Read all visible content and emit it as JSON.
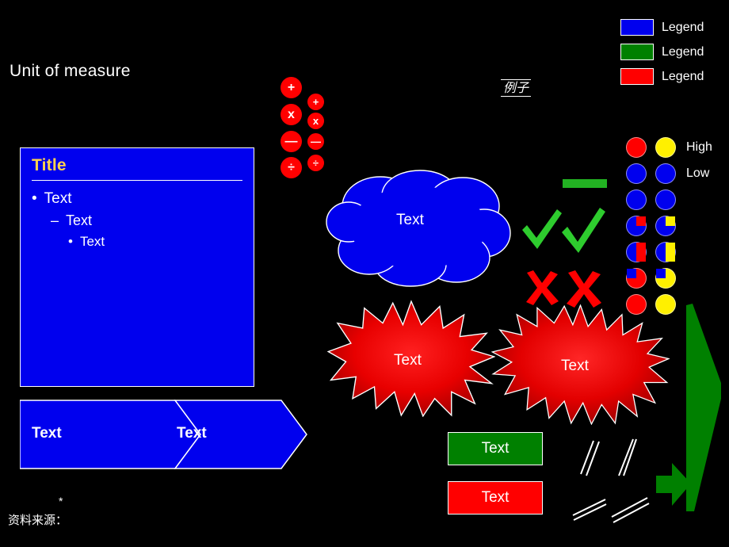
{
  "slide": {
    "background_color": "#000000",
    "heading": "Unit of measure"
  },
  "content_box": {
    "title": "Title",
    "title_color": "#FFD24D",
    "fill_color": "#0000EE",
    "bullets": [
      {
        "level": 1,
        "mark": "•",
        "text": "Text"
      },
      {
        "level": 2,
        "mark": "–",
        "text": "Text"
      },
      {
        "level": 3,
        "mark": "•",
        "text": "Text"
      }
    ]
  },
  "chevron": {
    "fill_color": "#0000EE",
    "segments": [
      {
        "label": "Text"
      },
      {
        "label": "Text"
      }
    ]
  },
  "footnote": {
    "star": "*",
    "source": "资料来源："
  },
  "math_symbols": {
    "large": [
      {
        "name": "plus-symbol",
        "glyph": "+"
      },
      {
        "name": "multiply-symbol",
        "glyph": "x"
      },
      {
        "name": "minus-symbol",
        "glyph": "—"
      },
      {
        "name": "divide-symbol",
        "glyph": "÷"
      }
    ],
    "small": [
      {
        "name": "plus-symbol",
        "glyph": "+"
      },
      {
        "name": "multiply-symbol",
        "glyph": "x"
      },
      {
        "name": "minus-symbol",
        "glyph": "—"
      },
      {
        "name": "divide-symbol",
        "glyph": "÷"
      }
    ],
    "fill_color": "#FF0000"
  },
  "example_label": {
    "text": "例子"
  },
  "legend": {
    "items": [
      {
        "color": "#0000EE",
        "label": "Legend"
      },
      {
        "color": "#008000",
        "label": "Legend"
      },
      {
        "color": "#FF0000",
        "label": "Legend"
      }
    ]
  },
  "harvey_balls": {
    "base_color": "#0000EE",
    "left_fill_color": "#FF0000",
    "right_fill_color": "#FFF000",
    "rows": [
      {
        "left_pct": 100,
        "right_pct": 100,
        "label": "High"
      },
      {
        "left_pct": 0,
        "right_pct": 0,
        "label": "Low"
      },
      {
        "left_pct": 0,
        "right_pct": 0,
        "label": ""
      },
      {
        "left_pct": 25,
        "right_pct": 25,
        "label": ""
      },
      {
        "left_pct": 50,
        "right_pct": 50,
        "label": ""
      },
      {
        "left_pct": 75,
        "right_pct": 75,
        "label": ""
      },
      {
        "left_pct": 100,
        "right_pct": 100,
        "label": ""
      }
    ]
  },
  "cloud": {
    "label": "Text",
    "fill_color": "#0000EE"
  },
  "starbursts": [
    {
      "label": "Text",
      "points": 16,
      "fill_color": "#FF0000"
    },
    {
      "label": "Text",
      "points": 24,
      "fill_color": "#FF0000"
    }
  ],
  "marks": {
    "green_bar_color": "#22B222",
    "checks": [
      {
        "name": "check-mark",
        "color": "#2ECC2E"
      },
      {
        "name": "check-mark",
        "color": "#2ECC2E"
      }
    ],
    "crosses": [
      {
        "name": "cross-mark",
        "color": "#FF0000"
      },
      {
        "name": "cross-mark",
        "color": "#FF0000"
      }
    ]
  },
  "status_boxes": [
    {
      "label": "Text",
      "color": "#008000"
    },
    {
      "label": "Text",
      "color": "#FF0000"
    }
  ],
  "axis_breaks": {
    "color": "#ffffff",
    "count": 4
  },
  "green_arrows": {
    "color": "#008000",
    "large_name": "tall-green-arrow",
    "small_name": "right-green-arrow"
  }
}
